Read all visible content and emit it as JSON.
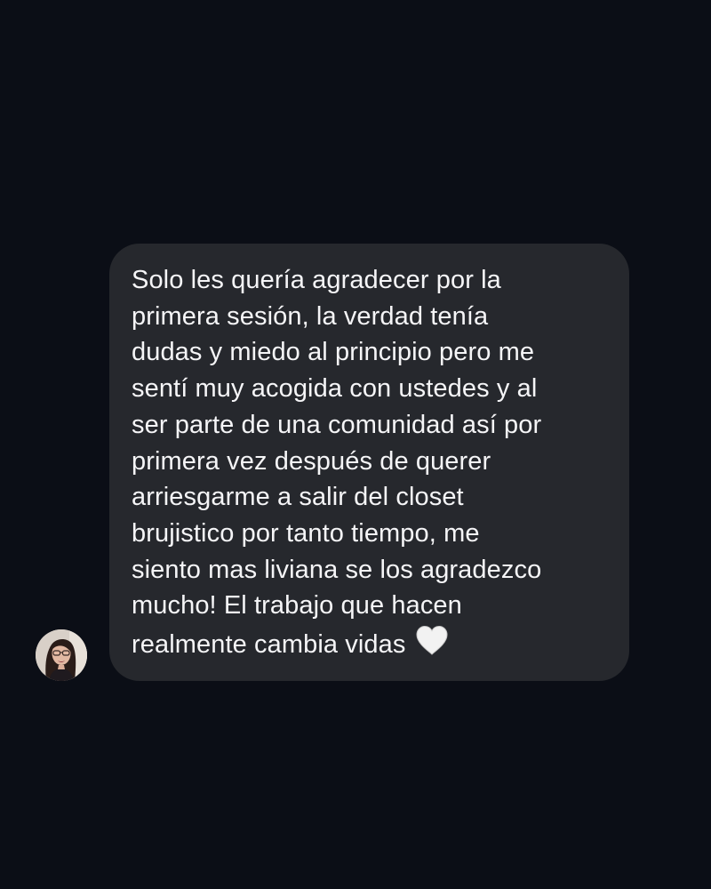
{
  "conversation": {
    "message": {
      "text": "Solo les quería agradecer por la\nprimera sesión, la verdad tenía\ndudas y miedo al principio pero me\nsentí muy acogida con ustedes y al\nser parte de una comunidad así por\nprimera vez después de querer\narriesgarme a salir del closet\nbrujistico por tanto tiempo, me\nsiento mas liviana se los agradezco\nmucho! El trabajo que hacen\nrealmente cambia vidas",
      "emoji": "white-heart",
      "sender_avatar": "avatar-photo"
    }
  },
  "colors": {
    "background": "#0b0e16",
    "bubble": "#26282d",
    "text": "#f5f5f7",
    "heart": "#f2f2f2"
  }
}
